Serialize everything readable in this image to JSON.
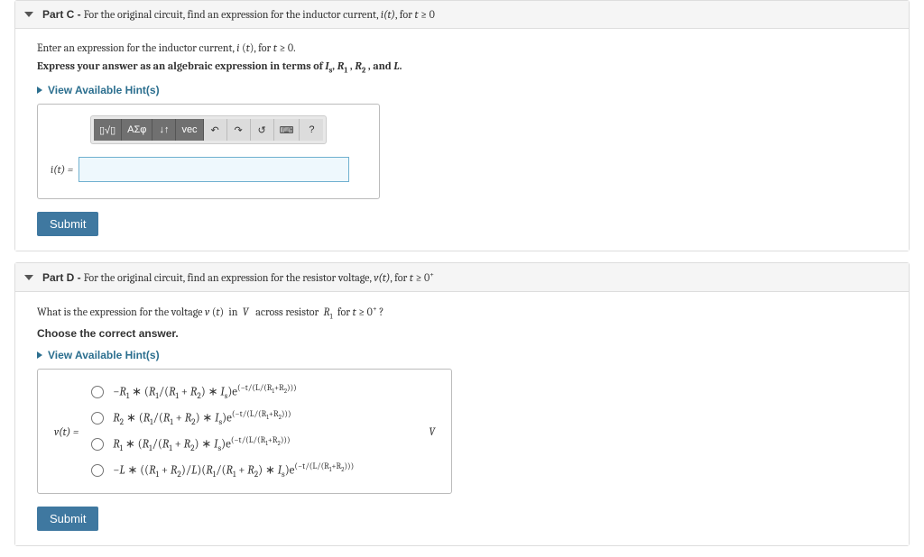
{
  "partC": {
    "title_prefix": "Part C -",
    "title_text": "For the original circuit, find an expression for the inductor current, i(t), for t ≥ 0",
    "instr_html": "Enter an expression for the inductor current, i (t), for t ≥ 0.",
    "bold_line": "Express your answer as an algebraic expression in terms of Is, R1, R2 , and L.",
    "hint_label": "View Available Hint(s)",
    "toolbox": {
      "templates": "▯√▯",
      "greek": "ΑΣφ",
      "subsup": "↓↑",
      "vec": "vec",
      "undo": "↶",
      "redo": "↷",
      "reset": "↺",
      "keyboard": "⌨",
      "help": "?"
    },
    "expr_label": "i(t) =",
    "expr_value": "",
    "submit_label": "Submit"
  },
  "partD": {
    "title_prefix": "Part D -",
    "title_rich": "For the original circuit, find an expression for the resistor voltage, v(t), for t ≥ 0⁺",
    "question_rich": "What is the expression for the voltage v (t)  in  V   across resistor  R1  for t ≥ 0⁺ ?",
    "choose_line": "Choose the correct answer.",
    "hint_label": "View Available Hint(s)",
    "vt_label": "v(t) =",
    "unit": "V",
    "choices": [
      {
        "text": "−R1 ∗ (R1/(R1 + R2) ∗ Is)e(−t/(L/(R1+R2)))",
        "html": "−<span class='ital'>R</span><sub>1</sub> ∗ (<span class='ital'>R</span><sub>1</sub>/(<span class='ital'>R</span><sub>1</sub> + <span class='ital'>R</span><sub>2</sub>) ∗ <span class='ital'>I</span><sub>s</sub>)e<sup>(−t/(L/(R<sub>1</sub>+R<sub>2</sub>)))</sup>"
      },
      {
        "text": "R2 ∗ (R1/(R1 + R2) ∗ Is)e(−t/(L/(R1+R2)))",
        "html": "<span class='ital'>R</span><sub>2</sub> ∗ (<span class='ital'>R</span><sub>1</sub>/(<span class='ital'>R</span><sub>1</sub> + <span class='ital'>R</span><sub>2</sub>) ∗ <span class='ital'>I</span><sub>s</sub>)e<sup>(−t/(L/(R<sub>1</sub>+R<sub>2</sub>)))</sup>"
      },
      {
        "text": "R1 ∗ (R1/(R1 + R2) ∗ Is)e(−t/(L/(R1+R2)))",
        "html": "<span class='ital'>R</span><sub>1</sub> ∗ (<span class='ital'>R</span><sub>1</sub>/(<span class='ital'>R</span><sub>1</sub> + <span class='ital'>R</span><sub>2</sub>) ∗ <span class='ital'>I</span><sub>s</sub>)e<sup>(−t/(L/(R<sub>1</sub>+R<sub>2</sub>)))</sup>"
      },
      {
        "text": "−L ∗ ((R1 + R2)/L)(R1/(R1 + R2) ∗ Is)e(−t/(L/(R1+R2)))",
        "html": "−<span class='ital'>L</span> ∗ ((<span class='ital'>R</span><sub>1</sub> + <span class='ital'>R</span><sub>2</sub>)/<span class='ital'>L</span>)(<span class='ital'>R</span><sub>1</sub>/(<span class='ital'>R</span><sub>1</sub> + <span class='ital'>R</span><sub>2</sub>) ∗ <span class='ital'>I</span><sub>s</sub>)e<sup>(−t/(L/(R<sub>1</sub>+R<sub>2</sub>)))</sup>"
      }
    ],
    "submit_label": "Submit"
  }
}
